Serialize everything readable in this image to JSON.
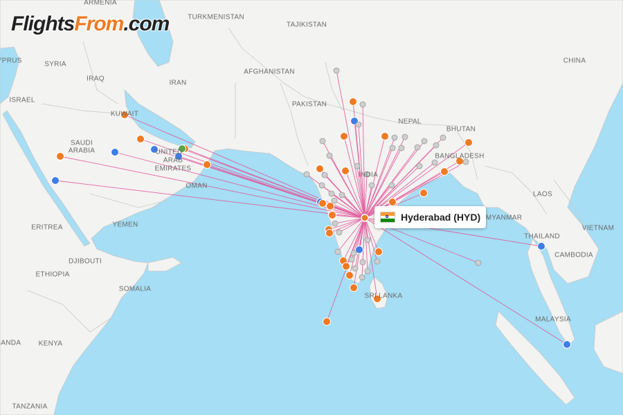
{
  "brand": {
    "part1": "Flights",
    "part2": "From",
    "part3": ".com"
  },
  "hub": {
    "label": "Hyderabad (HYD)",
    "flag": "india-flag-icon"
  },
  "colors": {
    "sea": "#a5def5",
    "land": "#f3f3f1",
    "border": "#c9c9c9",
    "route": "#e2559a",
    "orange": "#f07a22",
    "blue": "#3f7de6",
    "gray": "#cfcfcf",
    "green": "#5aa545"
  },
  "country_labels": [
    "ARMENIA",
    "TURKMENISTAN",
    "TAJIKISTAN",
    "CYPRUS",
    "SYRIA",
    "IRAQ",
    "IRAN",
    "AFGHANISTAN",
    "CHINA",
    "ISRAEL",
    "PAKISTAN",
    "KUWAIT",
    "NEPAL",
    "BHUTAN",
    "SAUDI",
    "ARABIA",
    "UNITED",
    "ARAB",
    "EMIRATES",
    "BANGLADESH",
    "INDIA",
    "OMAN",
    "LAOS",
    "MYANMAR",
    "ERITREA",
    "YEMEN",
    "VIETNAM",
    "THAILAND",
    "DJIBOUTI",
    "CAMBODIA",
    "ETHIOPIA",
    "SOMALIA",
    "SRI LANKA",
    "MALAYSIA",
    "UGANDA",
    "KENYA",
    "TANZANIA"
  ],
  "destination_colors": [
    "orange",
    "blue",
    "gray",
    "green"
  ]
}
